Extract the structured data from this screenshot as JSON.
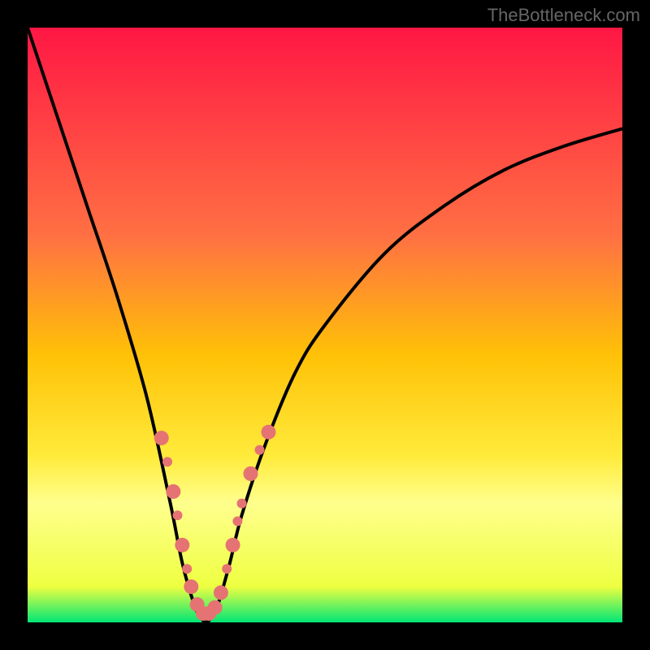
{
  "watermark": "TheBottleneck.com",
  "chart_data": {
    "type": "line",
    "title": "",
    "xlabel": "",
    "ylabel": "",
    "xlim": [
      0,
      100
    ],
    "ylim": [
      0,
      100
    ],
    "gradient_stops": [
      {
        "offset": 0,
        "color": "#ff1744"
      },
      {
        "offset": 35,
        "color": "#ff7043"
      },
      {
        "offset": 55,
        "color": "#ffc107"
      },
      {
        "offset": 72,
        "color": "#ffeb3b"
      },
      {
        "offset": 80,
        "color": "#ffff8d"
      },
      {
        "offset": 94,
        "color": "#eeff41"
      },
      {
        "offset": 100,
        "color": "#00e676"
      }
    ],
    "series": [
      {
        "name": "bottleneck-curve",
        "x": [
          0,
          5,
          10,
          15,
          20,
          24,
          26,
          28,
          29,
          30,
          31,
          32,
          34,
          36,
          40,
          45,
          50,
          60,
          70,
          80,
          90,
          100
        ],
        "y": [
          100,
          85,
          70,
          55,
          38,
          20,
          10,
          3,
          1,
          0,
          1,
          3,
          10,
          18,
          30,
          42,
          50,
          62,
          70,
          76,
          80,
          83
        ]
      }
    ],
    "markers": {
      "name": "data-points",
      "color": "#e57373",
      "radius_large": 9,
      "radius_small": 6,
      "points": [
        {
          "x": 22.5,
          "y": 31,
          "r": "large"
        },
        {
          "x": 23.5,
          "y": 27,
          "r": "small"
        },
        {
          "x": 24.5,
          "y": 22,
          "r": "large"
        },
        {
          "x": 25.2,
          "y": 18,
          "r": "small"
        },
        {
          "x": 26.0,
          "y": 13,
          "r": "large"
        },
        {
          "x": 26.8,
          "y": 9,
          "r": "small"
        },
        {
          "x": 27.5,
          "y": 6,
          "r": "large"
        },
        {
          "x": 28.5,
          "y": 3,
          "r": "large"
        },
        {
          "x": 29.5,
          "y": 1.5,
          "r": "large"
        },
        {
          "x": 30.5,
          "y": 1.5,
          "r": "large"
        },
        {
          "x": 31.5,
          "y": 2.5,
          "r": "large"
        },
        {
          "x": 32.5,
          "y": 5,
          "r": "large"
        },
        {
          "x": 33.5,
          "y": 9,
          "r": "small"
        },
        {
          "x": 34.5,
          "y": 13,
          "r": "large"
        },
        {
          "x": 35.3,
          "y": 17,
          "r": "small"
        },
        {
          "x": 36.0,
          "y": 20,
          "r": "small"
        },
        {
          "x": 37.5,
          "y": 25,
          "r": "large"
        },
        {
          "x": 39.0,
          "y": 29,
          "r": "small"
        },
        {
          "x": 40.5,
          "y": 32,
          "r": "large"
        }
      ]
    }
  }
}
